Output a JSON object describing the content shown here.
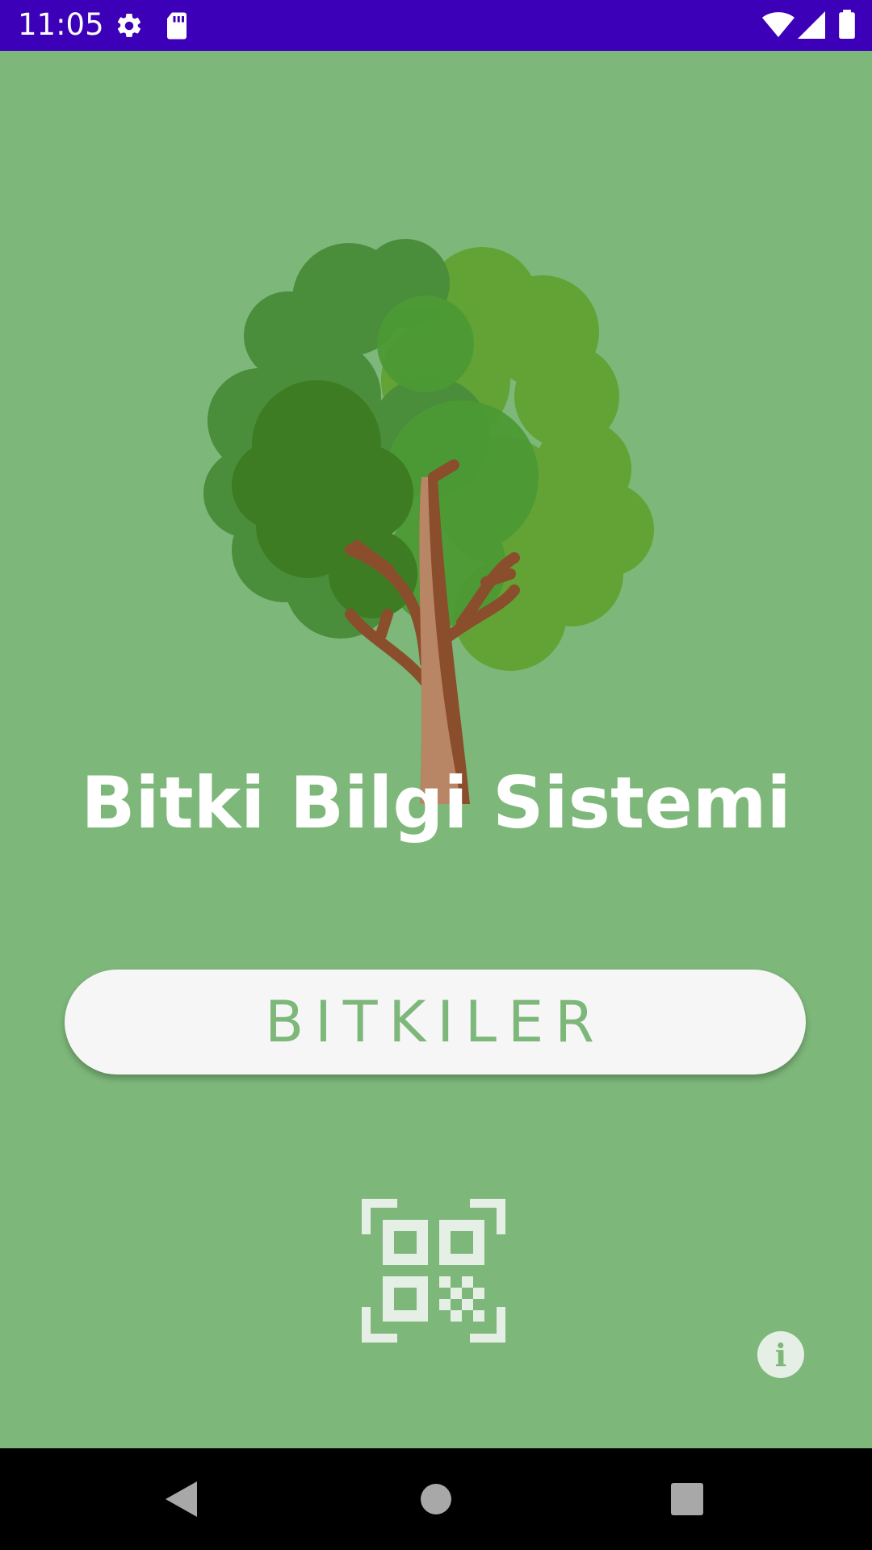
{
  "status_bar": {
    "time": "11:05",
    "background_color": "#3c00b8",
    "icons": [
      "settings-icon",
      "sd-card-icon",
      "wifi-icon",
      "signal-icon",
      "battery-icon"
    ]
  },
  "app": {
    "title": "Bitki Bilgi Sistemi",
    "background_color": "#7db77a",
    "plants_button_label": "BITKILER",
    "qr_scan_icon": "qr-code-scan-icon",
    "info_icon_glyph": "i"
  },
  "nav_bar": {
    "buttons": [
      "back-icon",
      "home-icon",
      "recents-icon"
    ]
  }
}
